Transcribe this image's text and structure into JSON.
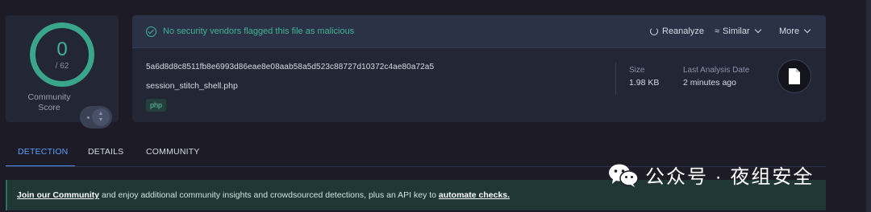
{
  "score": {
    "value": "0",
    "total": "/ 62",
    "community_label": "Community Score"
  },
  "banner": {
    "message": "No security vendors flagged this file as malicious",
    "reanalyze": "Reanalyze",
    "similar": "Similar",
    "more": "More"
  },
  "file": {
    "hash": "5a6d8d8c8511fb8e6993d86eae8e08aab58a5d523c88727d10372c4ae80a72a5",
    "name": "session_stitch_shell.php",
    "tag": "php",
    "size_label": "Size",
    "size_value": "1.98 KB",
    "analysis_label": "Last Analysis Date",
    "analysis_value": "2 minutes ago"
  },
  "tabs": [
    {
      "label": "DETECTION"
    },
    {
      "label": "DETAILS"
    },
    {
      "label": "COMMUNITY"
    }
  ],
  "join": {
    "link1": "Join our Community",
    "text": " and enjoy additional community insights and crowdsourced detections, plus an API key to ",
    "link2": "automate checks."
  },
  "watermark": {
    "text": "公众号 · 夜组安全"
  },
  "colors": {
    "accent": "#40b495",
    "tab_active": "#5aa0ff",
    "background": "#1c1b26"
  }
}
